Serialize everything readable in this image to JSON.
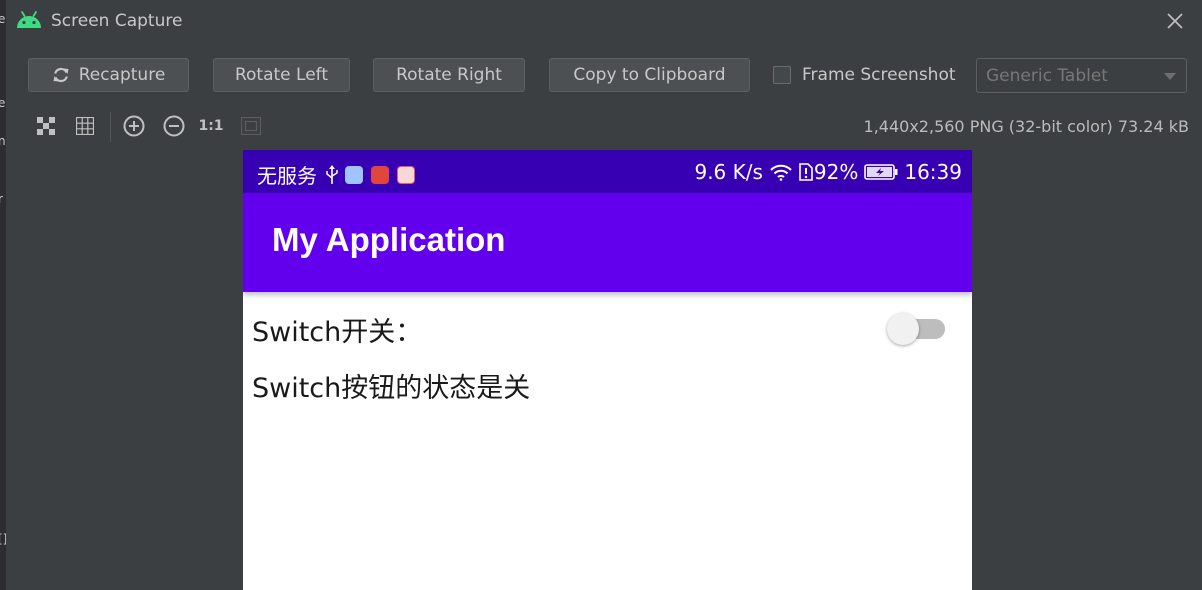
{
  "window": {
    "title": "Screen Capture",
    "left_strip_glyphs": [
      "e",
      "e",
      "nc",
      "r",
      "[]"
    ]
  },
  "toolbar": {
    "recapture_label": "Recapture",
    "rotate_left_label": "Rotate Left",
    "rotate_right_label": "Rotate Right",
    "copy_label": "Copy to Clipboard",
    "frame_screenshot_label": "Frame Screenshot",
    "frame_screenshot_checked": false,
    "device_select_value": "Generic Tablet"
  },
  "viewer": {
    "actual_size_label": "1:1",
    "image_info": "1,440x2,560 PNG (32-bit color) 73.24 kB"
  },
  "phone": {
    "status_bar": {
      "carrier": "无服务",
      "speed": "9.6 K/s",
      "battery": "92%",
      "time": "16:39"
    },
    "app_title": "My Application",
    "switch_label": "Switch开关：",
    "switch_on": false,
    "status_text": "Switch按钮的状态是关"
  },
  "colors": {
    "status_bar": "#3700b3",
    "app_bar": "#6200ee",
    "ide_background": "#3c3f41",
    "android_green": "#3ddc84"
  },
  "icons": {
    "title": "android-icon",
    "close": "close-icon",
    "recapture": "refresh-icon",
    "checkerboard": "checkerboard-icon",
    "grid": "grid-icon",
    "zoom_in": "zoom-in-icon",
    "zoom_out": "zoom-out-icon",
    "fit": "fit-screen-icon"
  }
}
